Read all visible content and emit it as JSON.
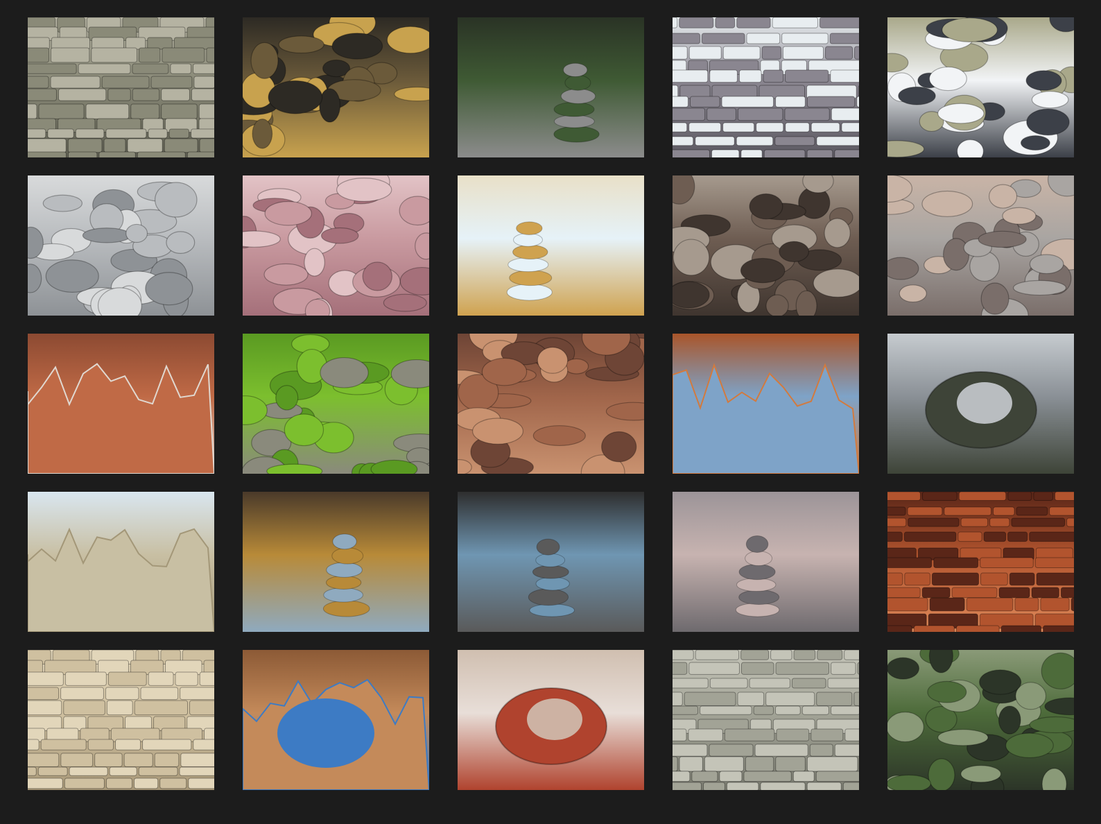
{
  "gallery": {
    "background": "#1c1c1c",
    "rows": 5,
    "columns": 5
  },
  "thumbnails": [
    {
      "subject": "layered-rock-cliff-texture",
      "colors": [
        "#8a8a78",
        "#5f5f52",
        "#b5b3a2"
      ]
    },
    {
      "subject": "wet-river-pebbles",
      "colors": [
        "#6b5a3a",
        "#c8a24e",
        "#2d2a24"
      ]
    },
    {
      "subject": "balanced-stone-cairn-in-forest",
      "colors": [
        "#3f5a34",
        "#8c8c8c",
        "#2a3325"
      ]
    },
    {
      "subject": "dry-stone-wall",
      "colors": [
        "#8a8690",
        "#5d5a63",
        "#e8edf0"
      ]
    },
    {
      "subject": "flat-stone-on-dark-pebble",
      "colors": [
        "#f2f4f6",
        "#3c4048",
        "#a9a88a"
      ]
    },
    {
      "subject": "grey-beach-pebbles",
      "colors": [
        "#b9bcbf",
        "#8e9296",
        "#d8dadb"
      ]
    },
    {
      "subject": "pink-smooth-pebbles",
      "colors": [
        "#c99aa0",
        "#a5707a",
        "#e2c3c6"
      ]
    },
    {
      "subject": "stacked-stones-on-white",
      "colors": [
        "#e6f2f8",
        "#cfa24f",
        "#e8e0c8"
      ]
    },
    {
      "subject": "large-boulders-closeup",
      "colors": [
        "#6e5d52",
        "#3f352f",
        "#a69a8e"
      ]
    },
    {
      "subject": "colorful-mixed-pebbles",
      "colors": [
        "#a9a5a2",
        "#7a6e6a",
        "#c9b4a6"
      ]
    },
    {
      "subject": "red-rock-formation-sky",
      "colors": [
        "#c06a46",
        "#e0d8d0",
        "#8c4a32"
      ]
    },
    {
      "subject": "boulder-on-green-grass",
      "colors": [
        "#7cbf2e",
        "#8a8a7c",
        "#5a9a22"
      ]
    },
    {
      "subject": "round-pebbles-on-sand",
      "colors": [
        "#a0654a",
        "#c99270",
        "#6e4536"
      ]
    },
    {
      "subject": "orange-sandstone-pillar",
      "colors": [
        "#7ea3c8",
        "#d27a3e",
        "#a9552a"
      ]
    },
    {
      "subject": "mossy-rock-in-stream",
      "colors": [
        "#8a9096",
        "#3e4438",
        "#c6cbcf"
      ]
    },
    {
      "subject": "white-limestone-cliffs",
      "colors": [
        "#c8bfa3",
        "#a39778",
        "#d9e6ef"
      ]
    },
    {
      "subject": "rock-cairn-on-seashore",
      "colors": [
        "#b88a38",
        "#8faabf",
        "#4a3a2a"
      ]
    },
    {
      "subject": "grey-cairn-by-ocean",
      "colors": [
        "#6f96b2",
        "#5a5a5a",
        "#2e2e2e"
      ]
    },
    {
      "subject": "cairn-on-misty-beach",
      "colors": [
        "#c7b3b0",
        "#6e6a6e",
        "#9c9498"
      ]
    },
    {
      "subject": "slot-canyon-orange-walls",
      "colors": [
        "#b2542e",
        "#e08a5a",
        "#5a2618"
      ]
    },
    {
      "subject": "beige-stone-block-wall",
      "colors": [
        "#cfc0a0",
        "#a89878",
        "#e2d6ba"
      ]
    },
    {
      "subject": "sandstone-double-arch",
      "colors": [
        "#c48a5a",
        "#3d7bc4",
        "#8c5a36"
      ]
    },
    {
      "subject": "striped-red-white-rock",
      "colors": [
        "#e8ded8",
        "#b0432e",
        "#d0bfb0"
      ]
    },
    {
      "subject": "grey-weathered-rock-face",
      "colors": [
        "#a2a396",
        "#7a7b70",
        "#c4c4b8"
      ]
    },
    {
      "subject": "mossy-green-boulders",
      "colors": [
        "#4d6b3a",
        "#2c3528",
        "#8a9a78"
      ]
    }
  ]
}
